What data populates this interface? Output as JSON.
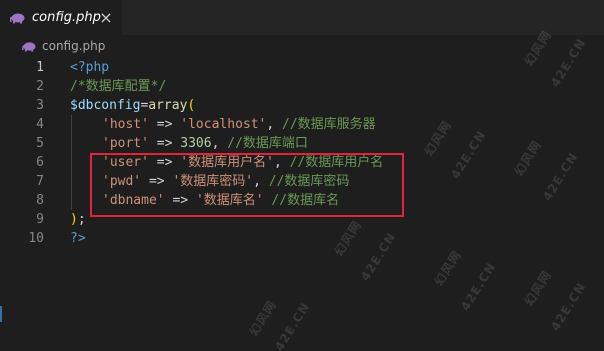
{
  "tab": {
    "label": "config.php",
    "close_icon": "×",
    "icon": "php-elephant-icon",
    "icon_color": "#a074c4"
  },
  "breadcrumb": {
    "label": "config.php",
    "icon": "php-elephant-icon"
  },
  "editor": {
    "line_numbers": [
      "1",
      "2",
      "3",
      "4",
      "5",
      "6",
      "7",
      "8",
      "9",
      "10"
    ],
    "lines": {
      "l1": {
        "open_tag": "<?php"
      },
      "l2": {
        "comment": "/*数据库配置*/"
      },
      "l3": {
        "variable": "$dbconfig",
        "assign": "=",
        "fn": "array",
        "paren": "("
      },
      "l4": {
        "key": "'host'",
        "arrow": " => ",
        "value": "'localhost'",
        "comma": ", ",
        "comment": "//数据库服务器"
      },
      "l5": {
        "key": "'port'",
        "arrow": " => ",
        "value": "3306",
        "comma": ", ",
        "comment": "//数据库端口"
      },
      "l6": {
        "key": "'user'",
        "arrow": " => ",
        "value": "'数据库用户名'",
        "comma": ", ",
        "comment": "//数据库用户名"
      },
      "l7": {
        "key": "'pwd'",
        "arrow": " => ",
        "value": "'数据库密码'",
        "comma": ", ",
        "comment": "//数据库密码"
      },
      "l8": {
        "key": "'dbname'",
        "arrow": " => ",
        "value": "'数据库名'",
        "comma": " ",
        "comment": "//数据库名"
      },
      "l9": {
        "paren": ")",
        "semi": ";"
      },
      "l10": {
        "close_tag": "?>"
      }
    },
    "highlight_color": "#e2233a"
  },
  "watermark": {
    "text_main": "幻风网",
    "text_domain": "42E.CN"
  }
}
